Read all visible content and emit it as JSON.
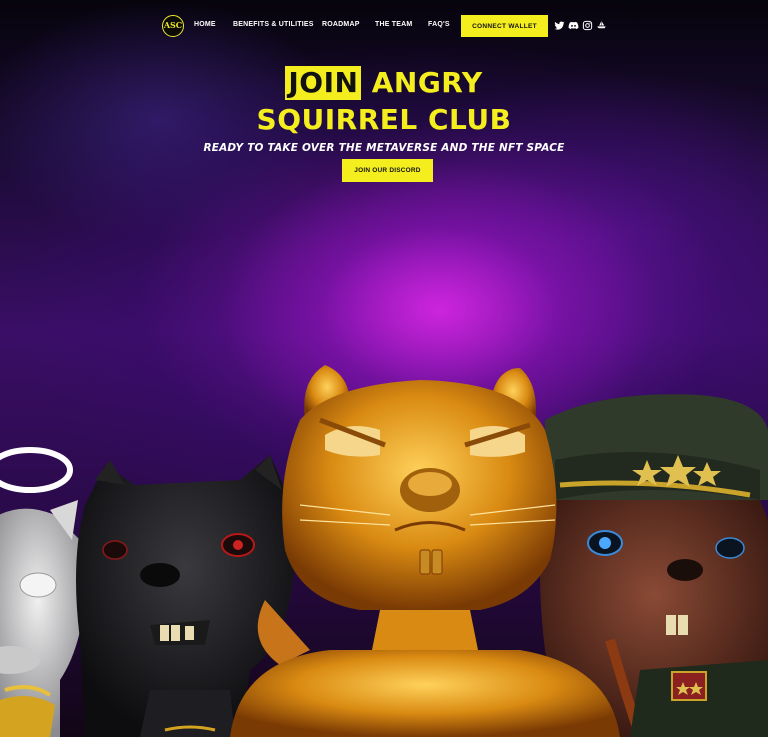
{
  "nav": {
    "logo_text": "ASC",
    "links": [
      "HOME",
      "BENEFITS & UTILITIES",
      "ROADMAP",
      "THE TEAM",
      "FAQ'S"
    ],
    "connect_label": "CONNECT WALLET",
    "socials": [
      "twitter-icon",
      "discord-icon",
      "instagram-icon",
      "opensea-icon"
    ]
  },
  "hero": {
    "title_highlight": "JOIN",
    "title_rest_line1": "ANGRY",
    "title_line2": "SQUIRREL CLUB",
    "subtitle": "READY TO TAKE OVER THE METAVERSE AND THE NFT SPACE",
    "cta_label": "JOIN OUR DISCORD"
  },
  "colors": {
    "accent": "#f5ee1e",
    "background": "#05030a",
    "glow": "#c81ee0"
  }
}
